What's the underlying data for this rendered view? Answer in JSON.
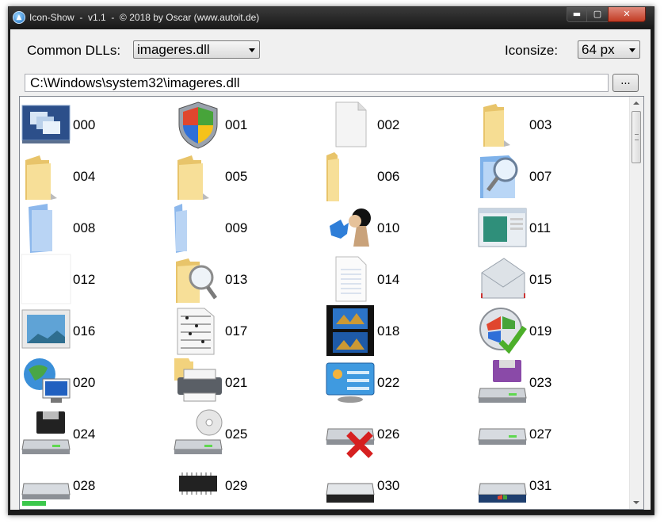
{
  "window": {
    "title": "Icon-Show  -  v1.1  -  © 2018 by Oscar (www.autoit.de)",
    "buttons": {
      "minimize": "▬",
      "maximize": "▢",
      "close": "✕"
    }
  },
  "toolbar": {
    "dll_label": "Common DLLs:",
    "dll_selected": "imageres.dll",
    "iconsize_label": "Iconsize:",
    "iconsize_selected": "64 px",
    "path_value": "C:\\Windows\\system32\\imageres.dll",
    "browse_label": "..."
  },
  "icons": [
    {
      "num": "000",
      "icon": "desktop-windows-icon"
    },
    {
      "num": "001",
      "icon": "security-shield-icon"
    },
    {
      "num": "002",
      "icon": "blank-document-icon"
    },
    {
      "num": "003",
      "icon": "folder-open-icon"
    },
    {
      "num": "004",
      "icon": "folder-icon"
    },
    {
      "num": "005",
      "icon": "folder-icon"
    },
    {
      "num": "006",
      "icon": "folder-narrow-icon"
    },
    {
      "num": "007",
      "icon": "search-folder-icon"
    },
    {
      "num": "008",
      "icon": "blue-folder-icon"
    },
    {
      "num": "009",
      "icon": "blue-folder-narrow-icon"
    },
    {
      "num": "010",
      "icon": "games-icon"
    },
    {
      "num": "011",
      "icon": "window-app-icon"
    },
    {
      "num": "012",
      "icon": "empty-icon"
    },
    {
      "num": "013",
      "icon": "folder-search-icon"
    },
    {
      "num": "014",
      "icon": "text-document-icon"
    },
    {
      "num": "015",
      "icon": "envelope-icon"
    },
    {
      "num": "016",
      "icon": "picture-icon"
    },
    {
      "num": "017",
      "icon": "music-sheet-icon"
    },
    {
      "num": "018",
      "icon": "video-film-icon"
    },
    {
      "num": "019",
      "icon": "windows-checkmark-icon"
    },
    {
      "num": "020",
      "icon": "network-globe-icon"
    },
    {
      "num": "021",
      "icon": "printer-folder-icon"
    },
    {
      "num": "022",
      "icon": "control-panel-icon"
    },
    {
      "num": "023",
      "icon": "floppy-drive-icon"
    },
    {
      "num": "024",
      "icon": "floppy-drive-black-icon"
    },
    {
      "num": "025",
      "icon": "cd-drive-icon"
    },
    {
      "num": "026",
      "icon": "drive-error-icon"
    },
    {
      "num": "027",
      "icon": "hard-drive-icon"
    },
    {
      "num": "028",
      "icon": "removable-drive-icon"
    },
    {
      "num": "029",
      "icon": "memory-chip-icon"
    },
    {
      "num": "030",
      "icon": "drive-dark-icon"
    },
    {
      "num": "031",
      "icon": "system-drive-icon"
    }
  ]
}
